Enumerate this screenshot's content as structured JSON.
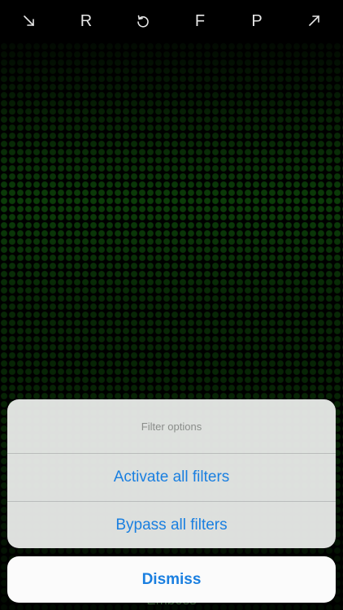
{
  "toolbar": {
    "items": [
      {
        "icon": "arrow-down-right-icon"
      },
      {
        "label": "R"
      },
      {
        "icon": "rotate-left-icon"
      },
      {
        "label": "F"
      },
      {
        "label": "P"
      },
      {
        "icon": "arrow-up-right-icon"
      }
    ]
  },
  "display": {
    "accent": "#2bd11d"
  },
  "background_label": "Emboss",
  "action_sheet": {
    "title": "Filter options",
    "actions": [
      {
        "label": "Activate all filters"
      },
      {
        "label": "Bypass all filters"
      }
    ],
    "cancel_label": "Dismiss",
    "action_color": "#1a7fe0"
  }
}
